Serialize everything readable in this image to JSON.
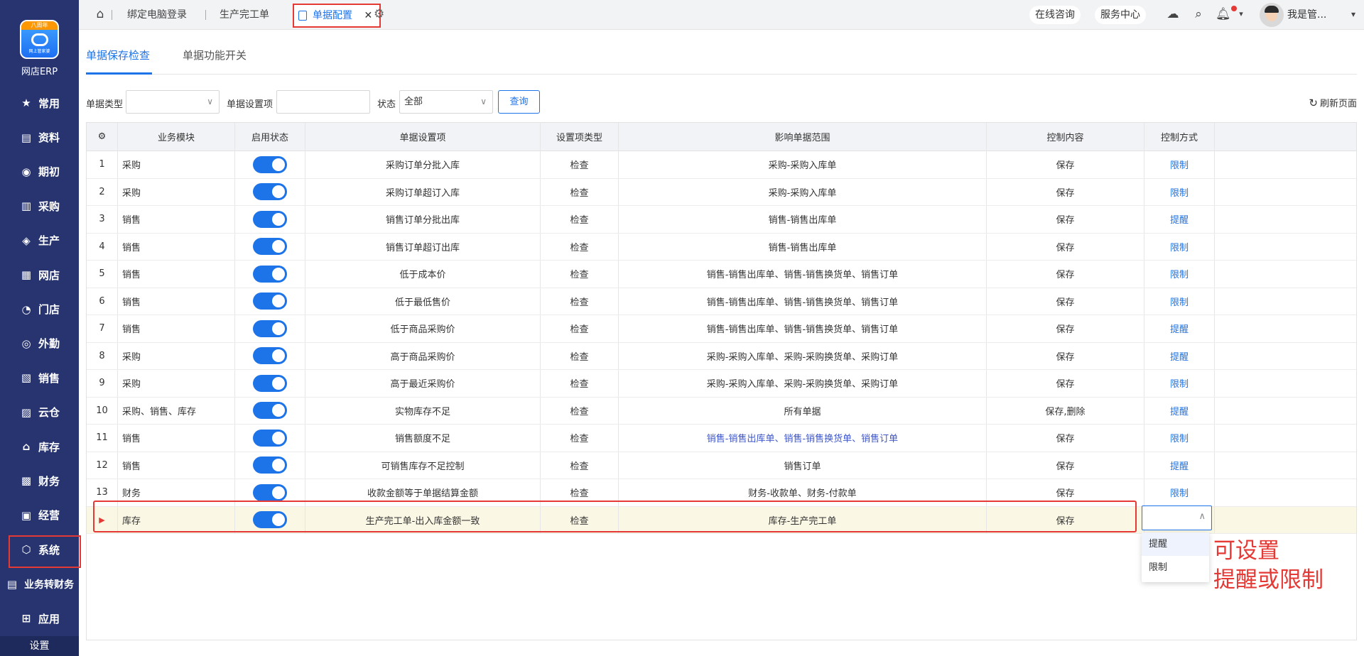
{
  "sidebar": {
    "logo_cap": "八周年",
    "logo_sub": "网上管家婆",
    "brand": "网店ERP",
    "items": [
      {
        "label": "常用",
        "icon": "★"
      },
      {
        "label": "资料",
        "icon": "▤"
      },
      {
        "label": "期初",
        "icon": "◉"
      },
      {
        "label": "采购",
        "icon": "▥"
      },
      {
        "label": "生产",
        "icon": "◈"
      },
      {
        "label": "网店",
        "icon": "▦"
      },
      {
        "label": "门店",
        "icon": "◔"
      },
      {
        "label": "外勤",
        "icon": "◎"
      },
      {
        "label": "销售",
        "icon": "▧"
      },
      {
        "label": "云仓",
        "icon": "▨"
      },
      {
        "label": "库存",
        "icon": "⌂"
      },
      {
        "label": "财务",
        "icon": "▩"
      },
      {
        "label": "经营",
        "icon": "▣"
      },
      {
        "label": "系统",
        "icon": "⬡"
      },
      {
        "label": "业务转财务",
        "icon": "▤"
      },
      {
        "label": "应用",
        "icon": "⊞"
      }
    ],
    "settings_label": "设置"
  },
  "topbar": {
    "tabs": [
      "绑定电脑登录",
      "生产完工单"
    ],
    "active_tab": "单据配置",
    "close": "✕",
    "online": "在线咨询",
    "service": "服务中心",
    "user": "我是管...",
    "caret": "▾"
  },
  "content_tabs": [
    "单据保存检查",
    "单据功能开关"
  ],
  "filters": {
    "type_label": "单据类型",
    "type_value": "",
    "item_label": "单据设置项",
    "item_value": "",
    "status_label": "状态",
    "status_value": "全部",
    "query": "查询",
    "refresh": "刷新页面"
  },
  "table": {
    "columns": [
      "业务模块",
      "启用状态",
      "单据设置项",
      "设置项类型",
      "影响单据范围",
      "控制内容",
      "控制方式"
    ],
    "rows": [
      {
        "no": "1",
        "module": "采购",
        "item": "采购订单分批入库",
        "type": "检查",
        "scope": "采购-采购入库单",
        "content": "保存",
        "mode": "限制"
      },
      {
        "no": "2",
        "module": "采购",
        "item": "采购订单超订入库",
        "type": "检查",
        "scope": "采购-采购入库单",
        "content": "保存",
        "mode": "限制"
      },
      {
        "no": "3",
        "module": "销售",
        "item": "销售订单分批出库",
        "type": "检查",
        "scope": "销售-销售出库单",
        "content": "保存",
        "mode": "提醒"
      },
      {
        "no": "4",
        "module": "销售",
        "item": "销售订单超订出库",
        "type": "检查",
        "scope": "销售-销售出库单",
        "content": "保存",
        "mode": "限制"
      },
      {
        "no": "5",
        "module": "销售",
        "item": "低于成本价",
        "type": "检查",
        "scope": "销售-销售出库单、销售-销售换货单、销售订单",
        "content": "保存",
        "mode": "限制"
      },
      {
        "no": "6",
        "module": "销售",
        "item": "低于最低售价",
        "type": "检查",
        "scope": "销售-销售出库单、销售-销售换货单、销售订单",
        "content": "保存",
        "mode": "限制"
      },
      {
        "no": "7",
        "module": "销售",
        "item": "低于商品采购价",
        "type": "检查",
        "scope": "销售-销售出库单、销售-销售换货单、销售订单",
        "content": "保存",
        "mode": "提醒"
      },
      {
        "no": "8",
        "module": "采购",
        "item": "高于商品采购价",
        "type": "检查",
        "scope": "采购-采购入库单、采购-采购换货单、采购订单",
        "content": "保存",
        "mode": "提醒"
      },
      {
        "no": "9",
        "module": "采购",
        "item": "高于最近采购价",
        "type": "检查",
        "scope": "采购-采购入库单、采购-采购换货单、采购订单",
        "content": "保存",
        "mode": "限制"
      },
      {
        "no": "10",
        "module": "采购、销售、库存",
        "item": "实物库存不足",
        "type": "检查",
        "scope": "所有单据",
        "content": "保存,删除",
        "mode": "提醒"
      },
      {
        "no": "11",
        "module": "销售",
        "item": "销售额度不足",
        "type": "检查",
        "scope": "销售-销售出库单、销售-销售换货单、销售订单",
        "content": "保存",
        "mode": "限制"
      },
      {
        "no": "12",
        "module": "销售",
        "item": "可销售库存不足控制",
        "type": "检查",
        "scope": "销售订单",
        "content": "保存",
        "mode": "提醒"
      },
      {
        "no": "13",
        "module": "财务",
        "item": "收款金额等于单据结算金额",
        "type": "检查",
        "scope": "财务-收款单、财务-付款单",
        "content": "保存",
        "mode": "限制"
      },
      {
        "no": "",
        "module": "库存",
        "item": "生产完工单-出入库金额一致",
        "type": "检查",
        "scope": "库存-生产完工单",
        "content": "保存",
        "mode": ""
      }
    ]
  },
  "dropdown": {
    "options": [
      "提醒",
      "限制"
    ]
  },
  "annotation": {
    "line1": "可设置",
    "line2": "提醒或限制"
  }
}
